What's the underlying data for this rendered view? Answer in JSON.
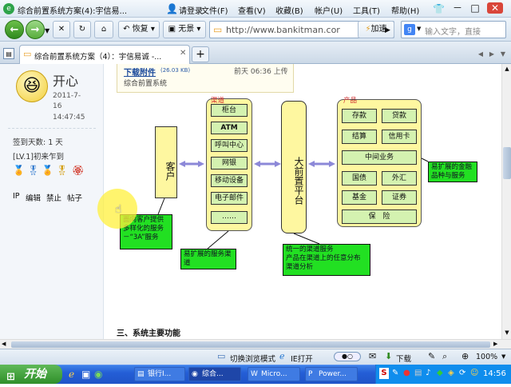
{
  "window": {
    "title": "综合前置系统方案(4):宇信易...",
    "menu": [
      "请登录",
      "文件(F)",
      "查看(V)",
      "收藏(B)",
      "帐户(U)",
      "工具(T)",
      "帮助(H)"
    ]
  },
  "nav": {
    "restore_label": "恢复",
    "noimage_label": "无景",
    "address": "http://www.bankitman.cor",
    "speed_label": "加速",
    "search_placeholder": "输入文字，直接"
  },
  "tab": {
    "label": "综合前置系统方案（4）：宇信易诚 -..."
  },
  "sidebar": {
    "username": "开心",
    "date": "2011-7-16",
    "time": "14:47:45",
    "signin_days": "签到天数: 1 天",
    "level": "[LV.1]初来乍到",
    "links": [
      "IP",
      "编辑",
      "禁止",
      "帖子"
    ]
  },
  "attachment": {
    "link": "下载附件",
    "size": "(26.03 KB)",
    "uploaded": "前天 06:36 上传",
    "filename": "综合前置系统"
  },
  "diagram": {
    "customer": "客户",
    "channel_label": "渠道",
    "channels": [
      "柜台",
      "ATM",
      "呼叫中心",
      "网银",
      "移动设备",
      "电子邮件",
      "……"
    ],
    "platform": "大前置平台",
    "product_label": "产品",
    "products_grid": [
      [
        "存款",
        "贷款"
      ],
      [
        "结算",
        "信用卡"
      ]
    ],
    "product_wide1": "中间业务",
    "products_grid2": [
      [
        "国债",
        "外汇"
      ],
      [
        "基金",
        "证券"
      ]
    ],
    "product_wide2": "保　险",
    "callout_customer": "面向客户提供多样化的服务－“3A”服务",
    "callout_channel": "易扩展的服务渠道",
    "callout_platform": "统一的渠道服务\n产品在渠道上的任意分布\n渠道分析",
    "callout_product": "易扩展的金融品种与服务"
  },
  "section_title": "三、系统主要功能",
  "status": {
    "mode": "切换浏览模式",
    "ie_open": "IE打开",
    "download": "下载",
    "zoom": "100%"
  },
  "taskbar": {
    "start": "开始",
    "tasks": [
      "银行I...",
      "综合...",
      "Micro...",
      "Power..."
    ],
    "clock": "14:56"
  }
}
